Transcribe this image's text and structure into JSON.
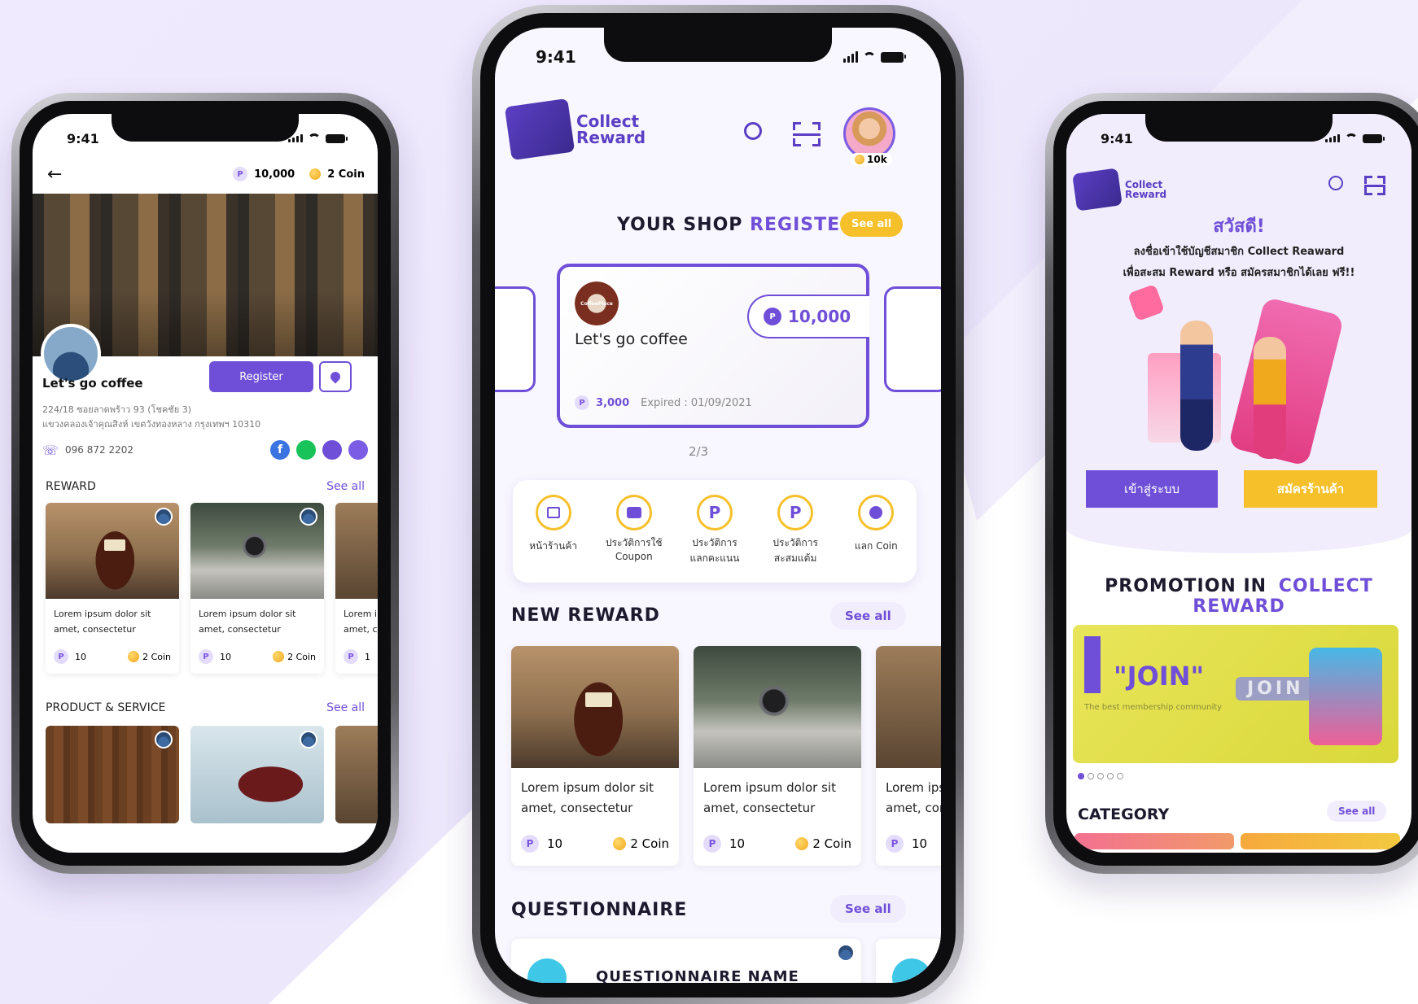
{
  "colors": {
    "primary": "#6f4fd7",
    "accent_yellow": "#f6c02b",
    "background": "#ebe4fc"
  },
  "status_time": "9:41",
  "left": {
    "points": "10,000",
    "points_badge": "P",
    "coins": "2 Coin",
    "shop_name": "Let's go coffee",
    "register_label": "Register",
    "address_line1": "224/18 ซอยลาดพร้าว 93 (โชคชัย 3)",
    "address_line2": "แขวงคลองเจ้าคุณสิงห์ เขตวังทองหลาง กรุงเทพฯ 10310",
    "phone": "096 872 2202",
    "reward_title": "REWARD",
    "see_all": "See all",
    "product_title": "PRODUCT & SERVICE",
    "rewards": [
      {
        "title": "Lorem ipsum dolor sit amet, consectetur",
        "points": "10",
        "coin": "2 Coin"
      },
      {
        "title": "Lorem ipsum dolor sit amet, consectetur",
        "points": "10",
        "coin": "2 Coin"
      },
      {
        "title": "Lorem ipsum dolor sit amet, consectetur",
        "points": "1",
        "coin": ""
      }
    ]
  },
  "center": {
    "logo_line1": "Collect",
    "logo_line2": "Reward",
    "avatar_coins": "10k",
    "section_title_a": "YOUR SHOP",
    "section_title_b": "REGISTER",
    "see_all": "See all",
    "card": {
      "shop_name": "Let's go coffee",
      "logo_text": "CoffeePlace",
      "points": "10,000",
      "sub_points": "3,000",
      "expired": "Expired : 01/09/2021"
    },
    "pager": "2/3",
    "menu": [
      {
        "label1": "หน้าร้านค้า",
        "label2": "",
        "icon": "shop-icon"
      },
      {
        "label1": "ประวัติการใช้",
        "label2": "Coupon",
        "icon": "coupon-icon"
      },
      {
        "label1": "ประวัติการ",
        "label2": "แลกคะแนน",
        "icon": "points-redeem-icon"
      },
      {
        "label1": "ประวัติการ",
        "label2": "สะสมแต้ม",
        "icon": "points-collect-icon"
      },
      {
        "label1": "แลก Coin",
        "label2": "",
        "icon": "coins-icon"
      }
    ],
    "new_reward_title": "NEW REWARD",
    "rewards": [
      {
        "title": "Lorem ipsum dolor sit amet, consectetur",
        "points": "10",
        "coin": "2 Coin"
      },
      {
        "title": "Lorem ipsum dolor sit amet, consectetur",
        "points": "10",
        "coin": "2 Coin"
      },
      {
        "title": "Lorem ipsum dolor sit amet, consectetur",
        "points": "10",
        "coin": ""
      }
    ],
    "questionnaire_title": "QUESTIONNAIRE",
    "questionnaire_name": "QUESTIONNAIRE NAME"
  },
  "right": {
    "logo_line1": "Collect",
    "logo_line2": "Reward",
    "greeting": "สวัสดี!",
    "desc_line1": "ลงชื่อเข้าใช้บัญชีสมาชิก Collect Reaward",
    "desc_line2": "เพื่อสะสม Reward หรือ สมัครสมาชิกได้เลย ฟรี!!",
    "login_label": "เข้าสู่ระบบ",
    "register_shop_label": "สมัครร้านค้า",
    "promo_title_a": "PROMOTION IN",
    "promo_title_b": "COLLECT REWARD",
    "banner_title": "\"JOIN\"",
    "banner_sub": "The best membership community",
    "banner_join": "JOIN",
    "category_title": "CATEGORY",
    "see_all": "See all"
  }
}
